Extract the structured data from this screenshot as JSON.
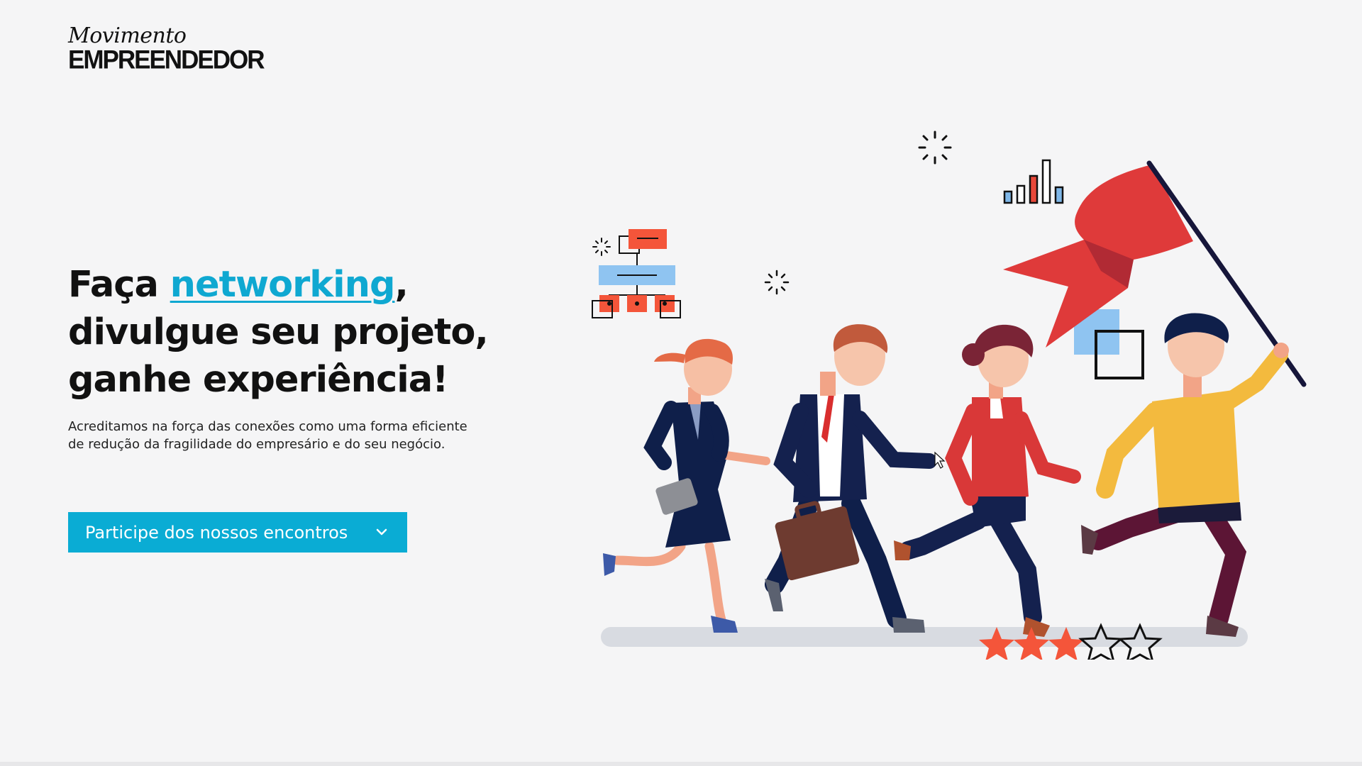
{
  "brand": {
    "script": "Movimento",
    "main": "EMPREENDEDOR"
  },
  "hero": {
    "headline_part1": "Faça ",
    "headline_highlight": "networking",
    "headline_part2": ",",
    "headline_line2": "divulgue seu projeto,",
    "headline_line3": "ganhe experiência!",
    "subtitle": "Acreditamos na força das conexões como uma forma eficiente de redução da fragilidade do empresário e do seu negócio."
  },
  "cta": {
    "label": "Participe dos nossos encontros",
    "icon": "chevron-down-icon"
  },
  "illustration": {
    "rating_filled": 3,
    "rating_total": 5
  },
  "colors": {
    "accent": "#0fa8d1",
    "button": "#0aacd4",
    "flag": "#e03a3a",
    "star": "#f4553a",
    "background": "#f5f5f6"
  }
}
